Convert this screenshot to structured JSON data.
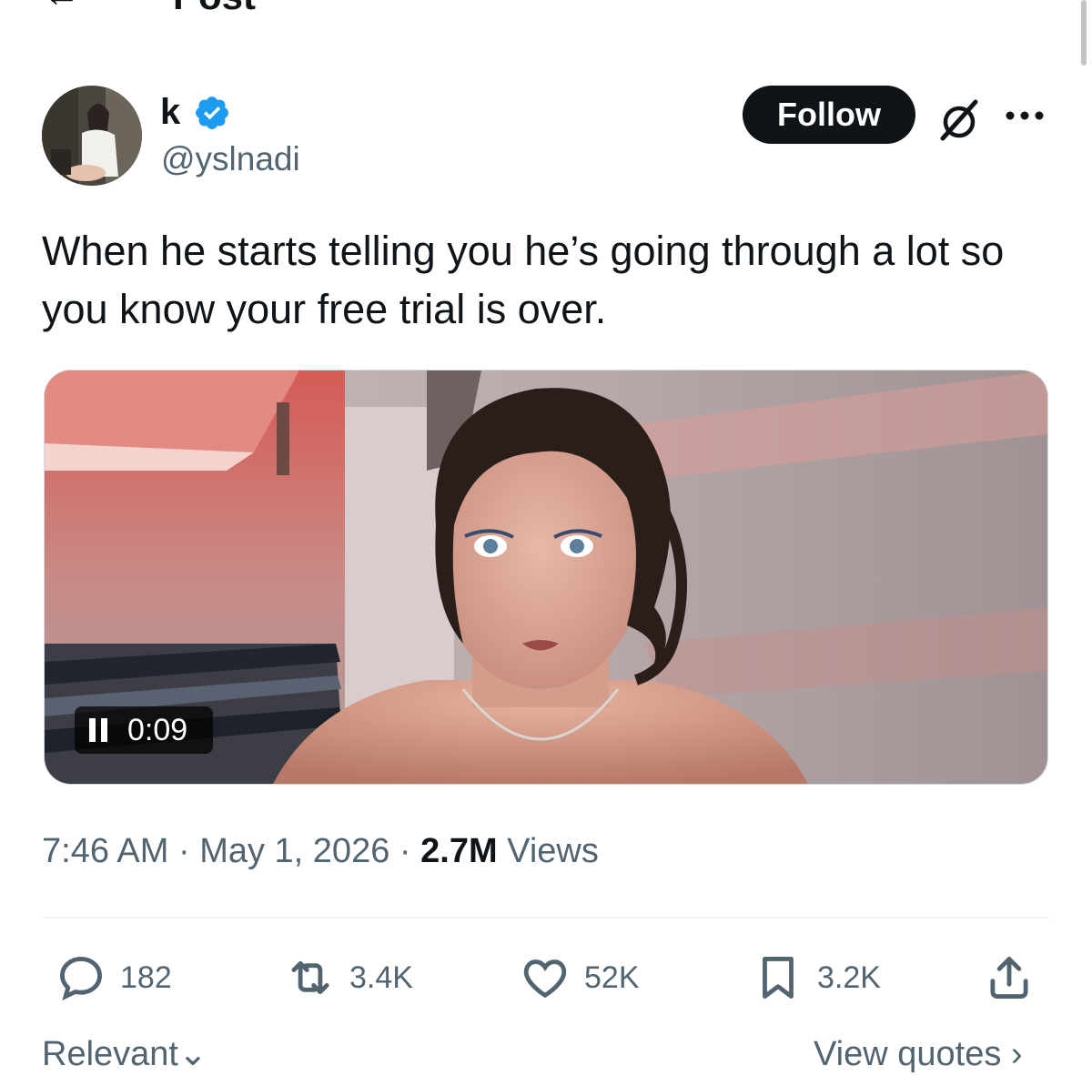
{
  "header": {
    "title": "Post",
    "back_icon": "back-arrow-icon"
  },
  "author": {
    "display_name": "k",
    "handle": "@yslnadi",
    "verified": true,
    "verified_color": "#1d9bf0"
  },
  "actions_top": {
    "follow_label": "Follow",
    "grok_icon": "grok-icon",
    "more_icon": "more-icon"
  },
  "tweet": {
    "text": "When he starts telling you he’s going through a lot so you know your free trial is over."
  },
  "media": {
    "type": "video",
    "duration": "0:09",
    "state": "playing"
  },
  "meta": {
    "time": "7:46 AM",
    "sep1": " · ",
    "date": "May 1, 2026",
    "sep2": " · ",
    "views_count": "2.7M",
    "views_label": " Views"
  },
  "engagement": {
    "replies": "182",
    "reposts": "3.4K",
    "likes": "52K",
    "bookmarks": "3.2K"
  },
  "bottom": {
    "sort_label": "Relevant",
    "sort_chevron": "⌄",
    "quotes_label": "View quotes",
    "quotes_chevron": "›"
  },
  "colors": {
    "text": "#0f1419",
    "secondary": "#536471",
    "accent": "#1d9bf0"
  }
}
